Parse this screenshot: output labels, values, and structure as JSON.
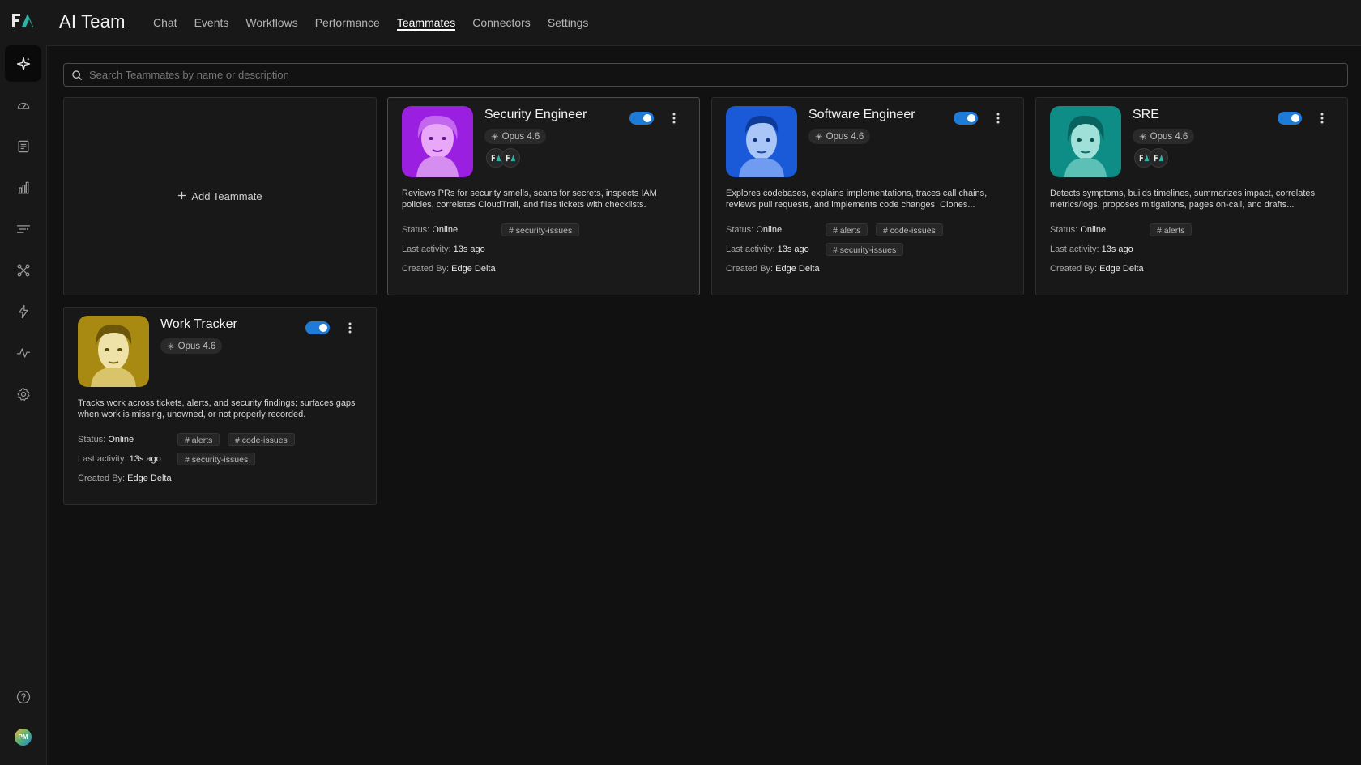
{
  "app": {
    "title": "AI Team"
  },
  "nav": {
    "items": [
      {
        "label": "Chat"
      },
      {
        "label": "Events"
      },
      {
        "label": "Workflows"
      },
      {
        "label": "Performance"
      },
      {
        "label": "Teammates",
        "active": true
      },
      {
        "label": "Connectors"
      },
      {
        "label": "Settings"
      }
    ]
  },
  "sidebar": {
    "items": [
      {
        "icon": "sparkle-icon",
        "active": true
      },
      {
        "icon": "gauge-icon"
      },
      {
        "icon": "document-icon"
      },
      {
        "icon": "bar-chart-icon"
      },
      {
        "icon": "filter-lines-icon"
      },
      {
        "icon": "graph-nodes-icon"
      },
      {
        "icon": "lightning-icon"
      },
      {
        "icon": "pulse-icon"
      },
      {
        "icon": "gear-icon"
      }
    ],
    "help_icon": "help-circle-icon",
    "user_initials": "PM"
  },
  "search": {
    "placeholder": "Search Teammates by name or description"
  },
  "add_card": {
    "label": "Add Teammate"
  },
  "labels": {
    "status": "Status:",
    "last_activity": "Last activity:",
    "created_by": "Created By:"
  },
  "teammates": [
    {
      "name": "Security Engineer",
      "model": "Opus 4.6",
      "enabled": true,
      "description": "Reviews PRs for security smells, scans for secrets, inspects IAM policies, correlates CloudTrail, and files tickets with checklists.",
      "status": "Online",
      "last_activity": "13s ago",
      "created_by": "Edge Delta",
      "tags": [
        "# security-issues"
      ],
      "portrait_color": "#9b1fe0"
    },
    {
      "name": "Software Engineer",
      "model": "Opus 4.6",
      "enabled": true,
      "description": "Explores codebases, explains implementations, traces call chains, reviews pull requests, and implements code changes. Clones...",
      "status": "Online",
      "last_activity": "13s ago",
      "created_by": "Edge Delta",
      "tags": [
        "# alerts",
        "# code-issues",
        "# security-issues"
      ],
      "portrait_color": "#1a5ad8"
    },
    {
      "name": "SRE",
      "model": "Opus 4.6",
      "enabled": true,
      "description": "Detects symptoms, builds timelines, summarizes impact, correlates metrics/logs, proposes mitigations, pages on-call, and drafts...",
      "status": "Online",
      "last_activity": "13s ago",
      "created_by": "Edge Delta",
      "tags": [
        "# alerts"
      ],
      "portrait_color": "#0e8c86"
    },
    {
      "name": "Work Tracker",
      "model": "Opus 4.6",
      "enabled": true,
      "description": "Tracks work across tickets, alerts, and security findings; surfaces gaps when work is missing, unowned, or not properly recorded.",
      "status": "Online",
      "last_activity": "13s ago",
      "created_by": "Edge Delta",
      "tags": [
        "# alerts",
        "# code-issues",
        "# security-issues"
      ],
      "portrait_color": "#a88a12"
    }
  ],
  "colors": {
    "accent": "#1e7bd8",
    "background": "#111111"
  }
}
